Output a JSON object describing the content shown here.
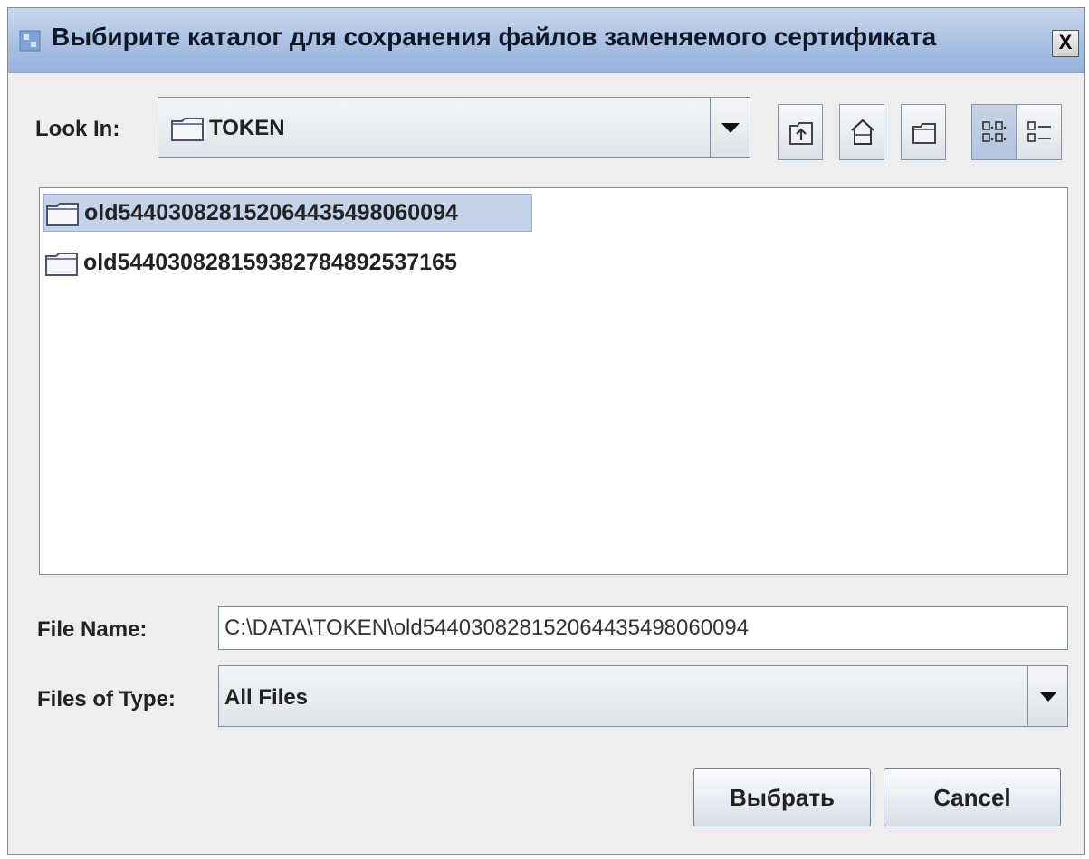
{
  "window": {
    "title": "Выбирите каталог для сохранения файлов заменяемого сертификата",
    "close_label": "X"
  },
  "look_in": {
    "label": "Look In:",
    "value": "TOKEN"
  },
  "toolbar": {
    "buttons": [
      {
        "name": "up-one-level",
        "icon": "folder-up-icon"
      },
      {
        "name": "home",
        "icon": "home-icon"
      },
      {
        "name": "new-folder",
        "icon": "new-folder-icon"
      },
      {
        "name": "list-view",
        "icon": "list-view-icon",
        "pressed": true
      },
      {
        "name": "details-view",
        "icon": "details-view-icon",
        "pressed": false
      }
    ]
  },
  "files": [
    {
      "name": "old544030828152064435498060094",
      "selected": true
    },
    {
      "name": "old544030828159382784892537165",
      "selected": false
    }
  ],
  "file_name": {
    "label": "File Name:",
    "value": "C:\\DATA\\TOKEN\\old544030828152064435498060094"
  },
  "file_type": {
    "label": "Files of Type:",
    "value": "All Files"
  },
  "buttons": {
    "select": "Выбрать",
    "cancel": "Cancel"
  },
  "colors": {
    "titlebar": "#a9c0e3",
    "dialog_bg": "#eeeeee",
    "selection": "#c4d2ea"
  }
}
